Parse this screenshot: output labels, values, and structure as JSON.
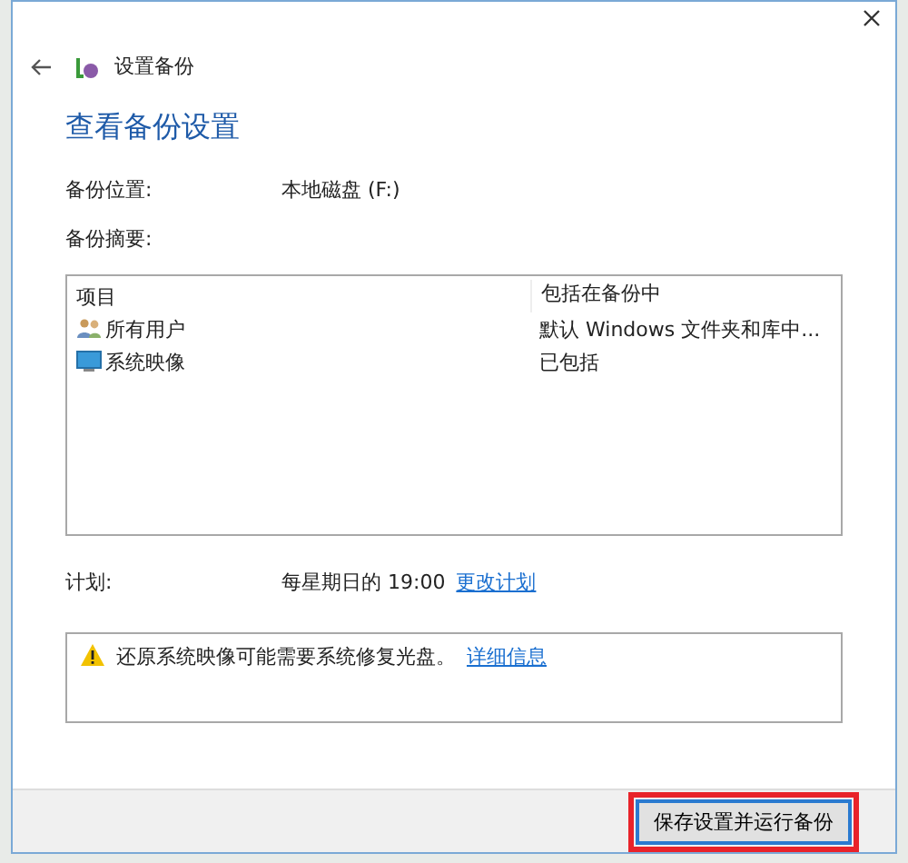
{
  "window": {
    "title": "设置备份"
  },
  "heading": "查看备份设置",
  "location": {
    "label": "备份位置:",
    "value": "本地磁盘 (F:)"
  },
  "summary": {
    "label": "备份摘要:"
  },
  "table": {
    "columns": [
      "项目",
      "包括在备份中"
    ],
    "rows": [
      {
        "kind": "users",
        "item": "所有用户",
        "included": "默认 Windows 文件夹和库中..."
      },
      {
        "kind": "image",
        "item": "系统映像",
        "included": "已包括"
      }
    ]
  },
  "schedule": {
    "label": "计划:",
    "value": "每星期日的 19:00",
    "link": "更改计划"
  },
  "notice": {
    "text": "还原系统映像可能需要系统修复光盘。",
    "link": "详细信息"
  },
  "buttons": [
    {
      "label": "保存设置并运行备份",
      "highlighted": true
    }
  ]
}
